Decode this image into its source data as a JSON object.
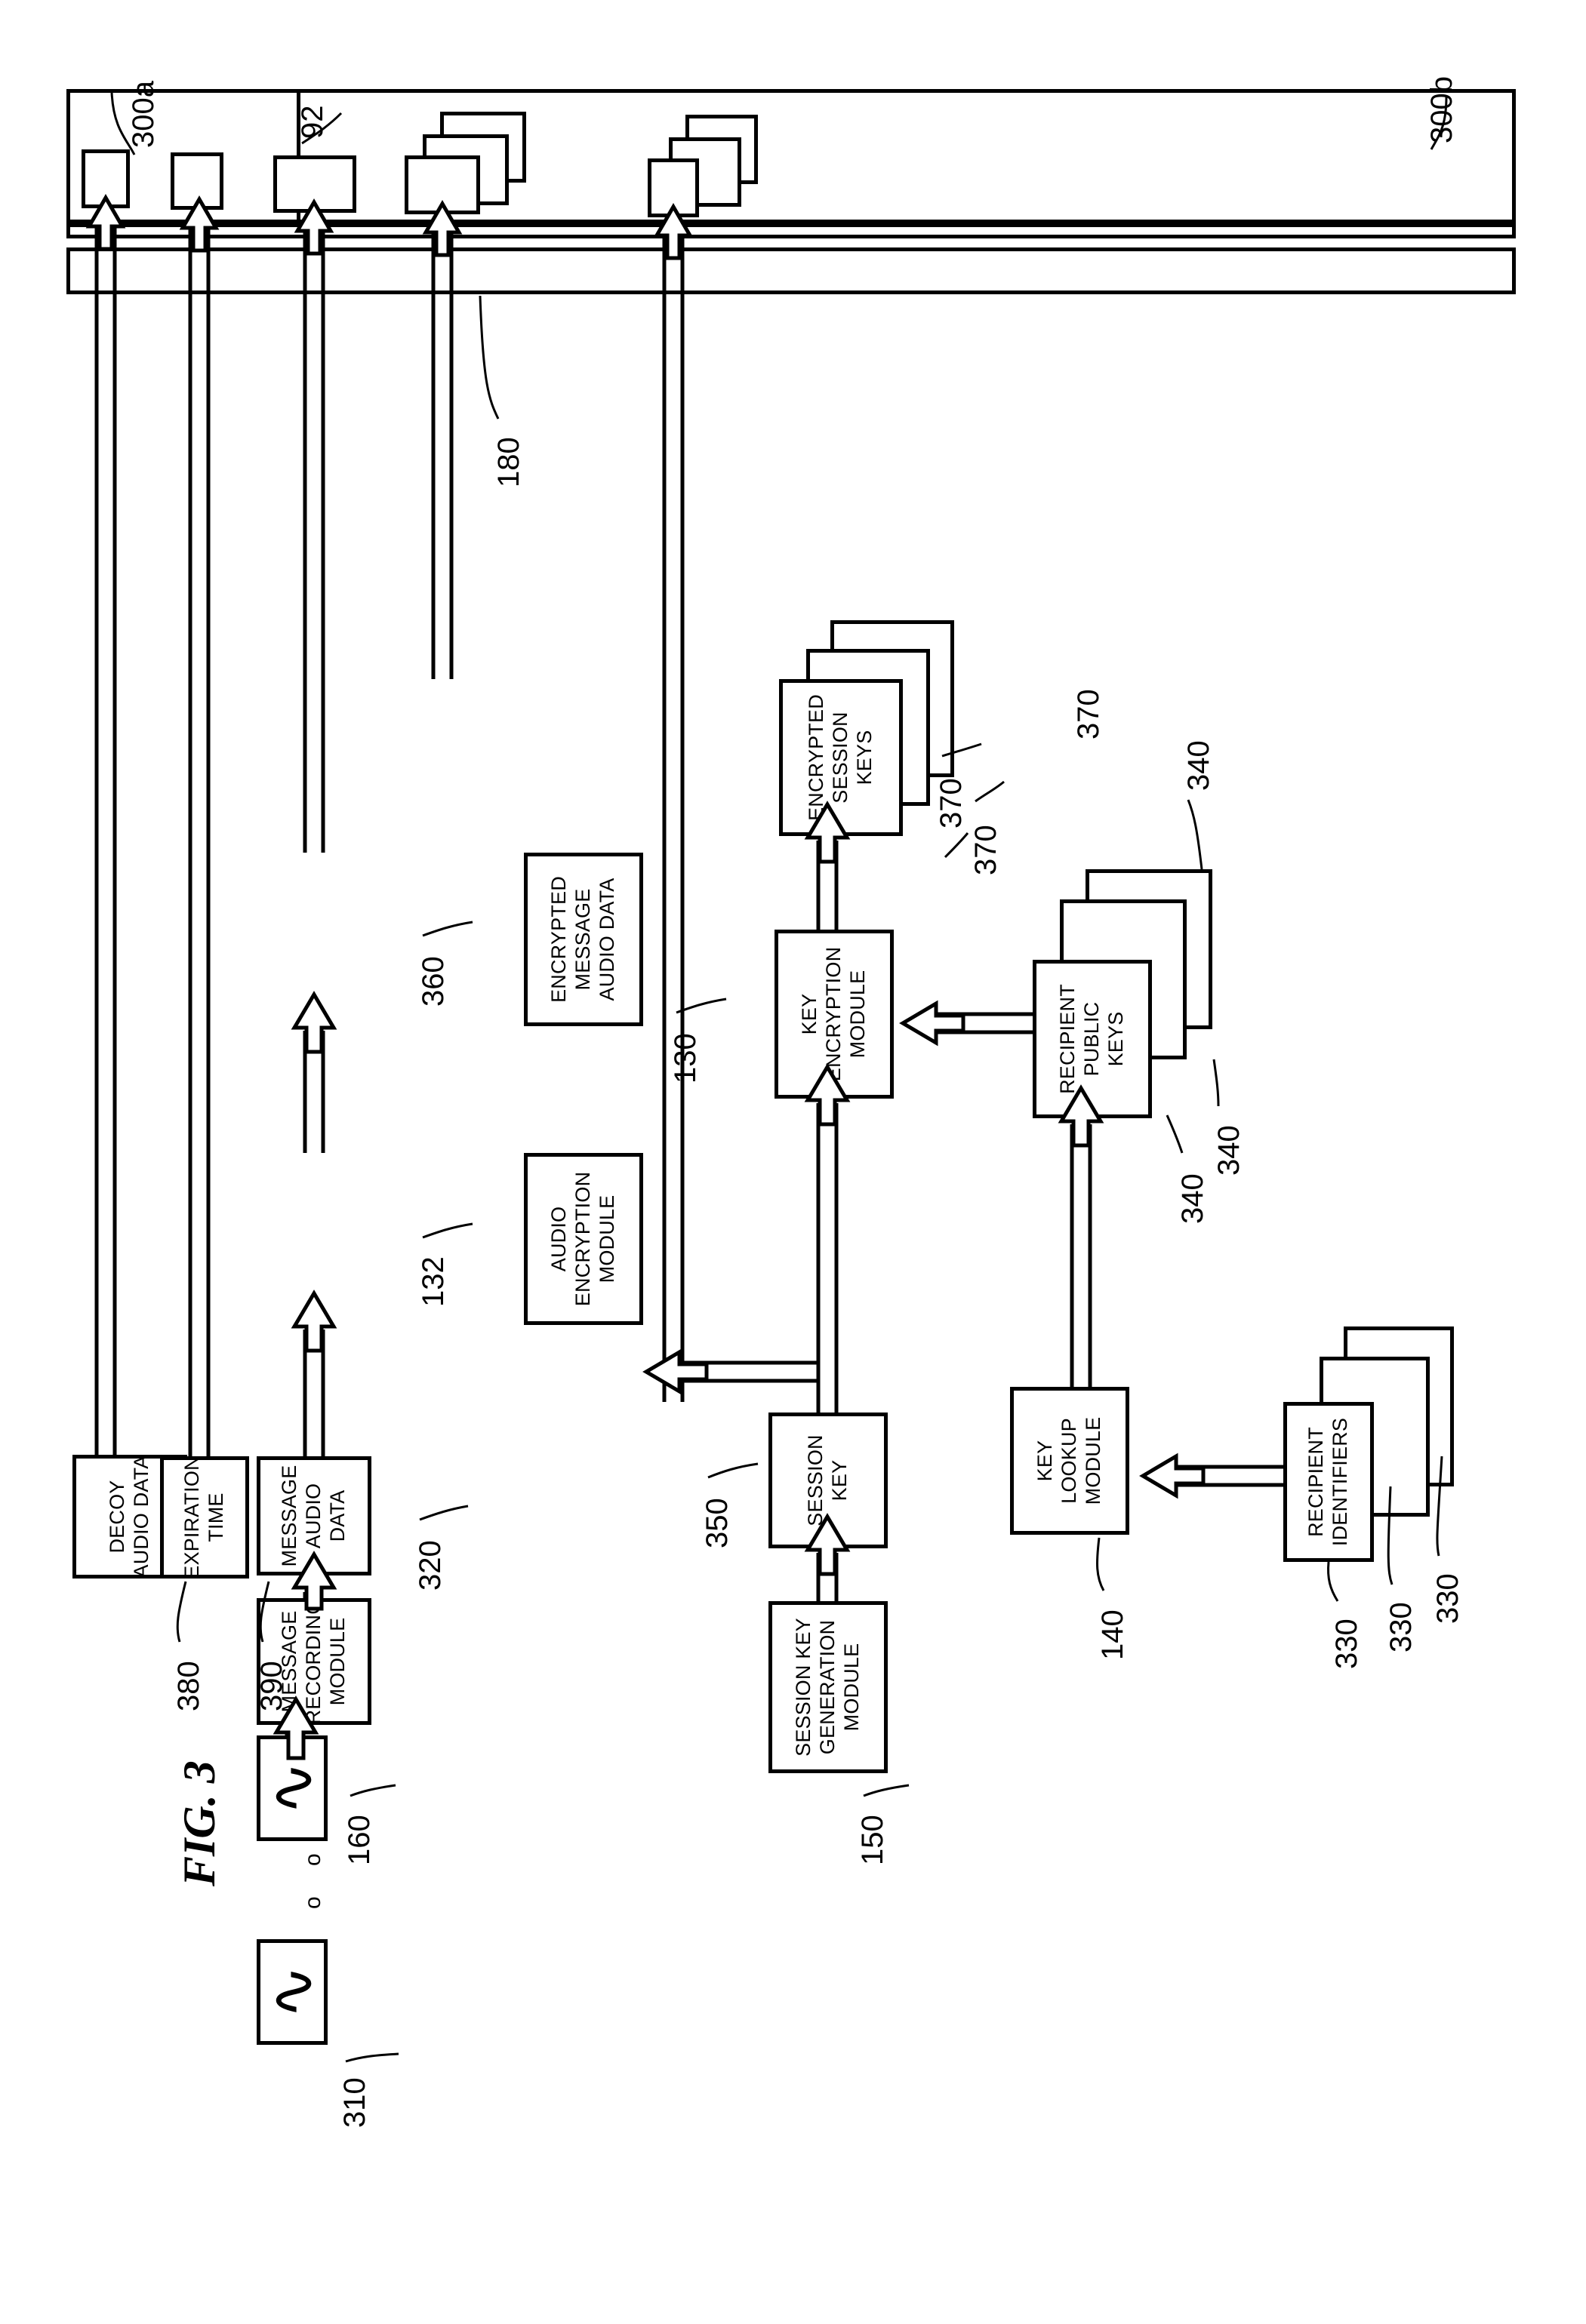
{
  "figure": {
    "caption": "FIG. 3"
  },
  "colors": {
    "ink": "#000000",
    "paper": "#ffffff"
  },
  "containers": [
    {
      "id": "device_a",
      "ref": "300a"
    },
    {
      "id": "network",
      "ref": "92"
    },
    {
      "id": "device_b",
      "ref": "300b"
    },
    {
      "id": "transport",
      "ref": "180"
    }
  ],
  "blocks": [
    {
      "id": "audio_input_1",
      "ref": "310",
      "label": "",
      "glyph": "squiggle"
    },
    {
      "id": "audio_input_n",
      "ref": "",
      "label": "",
      "glyph": "squiggle"
    },
    {
      "id": "decoy_audio",
      "ref": "380",
      "label": "DECOY\nAUDIO DATA"
    },
    {
      "id": "expiration_time",
      "ref": "390",
      "label": "EXPIRATION\nTIME"
    },
    {
      "id": "msg_rec_module",
      "ref": "160",
      "label": "MESSAGE\nRECORDING\nMODULE"
    },
    {
      "id": "message_audio",
      "ref": "320",
      "label": "MESSAGE\nAUDIO\nDATA"
    },
    {
      "id": "audio_enc_mod",
      "ref": "132",
      "label": "AUDIO\nENCRYPTION\nMODULE"
    },
    {
      "id": "enc_msg_audio",
      "ref": "360",
      "label": "ENCRYPTED\nMESSAGE\nAUDIO DATA"
    },
    {
      "id": "sk_gen_module",
      "ref": "150",
      "label": "SESSION KEY\nGENERATION\nMODULE"
    },
    {
      "id": "session_key",
      "ref": "350",
      "label": "SESSION\nKEY"
    },
    {
      "id": "key_enc_module",
      "ref": "130",
      "label": "KEY\nENCRYPTION\nMODULE"
    },
    {
      "id": "enc_session_keys",
      "ref": "370",
      "label": "ENCRYPTED\nSESSION\nKEYS",
      "stacked": 3
    },
    {
      "id": "key_lookup_mod",
      "ref": "140",
      "label": "KEY\nLOOKUP\nMODULE"
    },
    {
      "id": "recip_pub_keys",
      "ref": "340",
      "label": "RECIPIENT\nPUBLIC\nKEYS",
      "stacked": 3
    },
    {
      "id": "recip_ids",
      "ref": "330",
      "label": "RECIPIENT\nIDENTIFIERS",
      "stacked": 3
    }
  ],
  "ref_labels": [
    "300a",
    "92",
    "300b",
    "180",
    "310",
    "380",
    "390",
    "160",
    "320",
    "132",
    "360",
    "150",
    "350",
    "130",
    "370",
    "370",
    "370",
    "140",
    "340",
    "340",
    "340",
    "330",
    "330",
    "330"
  ],
  "ellipsis": "o o o"
}
